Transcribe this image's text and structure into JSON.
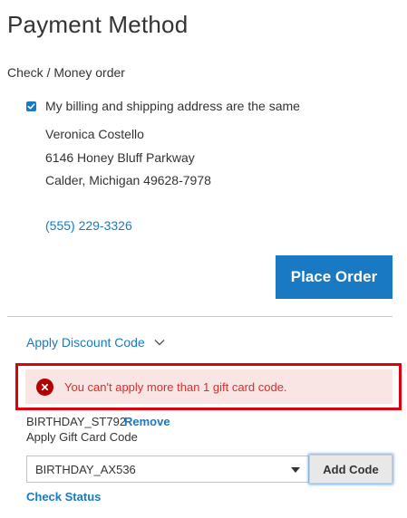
{
  "page": {
    "title": "Payment Method"
  },
  "payment": {
    "method_label": "Check / Money order",
    "same_address_checked": true,
    "same_address_label": "My billing and shipping address are the same",
    "address": {
      "name": "Veronica Costello",
      "street": "6146 Honey Bluff Parkway",
      "city_line": "Calder, Michigan 49628-7978",
      "phone": "(555) 229-3326"
    },
    "place_order_label": "Place Order"
  },
  "discount": {
    "toggle_label": "Apply Discount Code"
  },
  "gift_card": {
    "error_message": "You can't apply more than 1 gift card code.",
    "applied_code": "BIRTHDAY_ST792",
    "remove_label": "Remove",
    "apply_label": "Apply Gift Card Code",
    "selected_code": "BIRTHDAY_AX536",
    "add_code_label": "Add Code",
    "check_status_label": "Check Status"
  },
  "colors": {
    "primary": "#1979c3",
    "error_text": "#e02b27",
    "error_bg": "#fae5e5",
    "highlight_outline": "#e0000d"
  },
  "icons": {
    "checkbox": "checkmark-icon",
    "toggle": "chevron-down-icon",
    "error": "error-x-icon",
    "select": "caret-down-icon"
  }
}
